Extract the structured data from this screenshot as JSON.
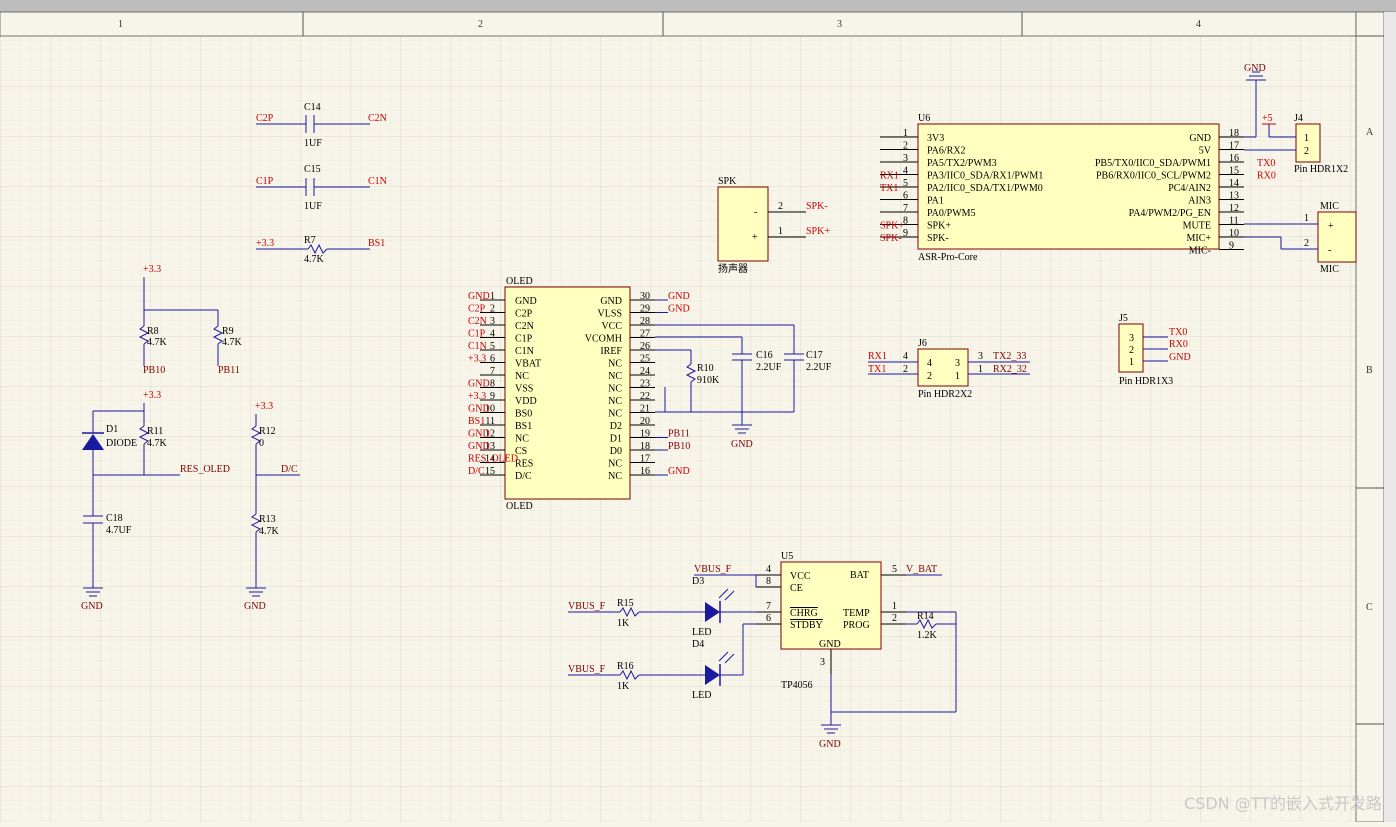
{
  "zones": {
    "columns": [
      "1",
      "2",
      "3",
      "4"
    ],
    "rows": [
      "A",
      "B",
      "C"
    ]
  },
  "caps": [
    {
      "ref": "C14",
      "value": "1UF",
      "left": "C2P",
      "right": "C2N"
    },
    {
      "ref": "C15",
      "value": "1UF",
      "left": "C1P",
      "right": "C1N"
    }
  ],
  "r7": {
    "ref": "R7",
    "value": "4.7K",
    "left": "+3.3",
    "right": "BS1"
  },
  "pullups": {
    "supply1": "+3.3",
    "supply2": "+3.3",
    "supply3": "+3.3",
    "r8": {
      "ref": "R8",
      "value": "4.7K",
      "net": "PB10"
    },
    "r9": {
      "ref": "R9",
      "value": "4.7K",
      "net": "PB11"
    },
    "d1": {
      "ref": "D1",
      "value": "DIODE"
    },
    "r11": {
      "ref": "R11",
      "value": "4.7K"
    },
    "c18": {
      "ref": "C18",
      "value": "4.7UF"
    },
    "res_net": "RES_OLED",
    "r12": {
      "ref": "R12",
      "value": "0"
    },
    "r13": {
      "ref": "R13",
      "value": "4.7K"
    },
    "dc_net": "D/C",
    "gnd": "GND"
  },
  "oled": {
    "ref": "OLED",
    "name": "OLED",
    "left_pins": [
      {
        "n": "1",
        "label": "GND",
        "net": "GND"
      },
      {
        "n": "2",
        "label": "C2P",
        "net": "C2P"
      },
      {
        "n": "3",
        "label": "C2N",
        "net": "C2N"
      },
      {
        "n": "4",
        "label": "C1P",
        "net": "C1P"
      },
      {
        "n": "5",
        "label": "C1N",
        "net": "C1N"
      },
      {
        "n": "6",
        "label": "VBAT",
        "net": "+3.3"
      },
      {
        "n": "7",
        "label": "NC",
        "net": ""
      },
      {
        "n": "8",
        "label": "VSS",
        "net": "GND"
      },
      {
        "n": "9",
        "label": "VDD",
        "net": "+3.3"
      },
      {
        "n": "10",
        "label": "BS0",
        "net": "GND"
      },
      {
        "n": "11",
        "label": "BS1",
        "net": "BS1"
      },
      {
        "n": "12",
        "label": "NC",
        "net": "GND"
      },
      {
        "n": "13",
        "label": "CS",
        "net": "GND"
      },
      {
        "n": "14",
        "label": "RES",
        "net": "RES_OLED"
      },
      {
        "n": "15",
        "label": "D/C",
        "net": "D/C"
      }
    ],
    "right_pins": [
      {
        "n": "30",
        "label": "GND",
        "net": "GND"
      },
      {
        "n": "29",
        "label": "VLSS",
        "net": "GND"
      },
      {
        "n": "28",
        "label": "VCC",
        "net": ""
      },
      {
        "n": "27",
        "label": "VCOMH",
        "net": ""
      },
      {
        "n": "26",
        "label": "IREF",
        "net": ""
      },
      {
        "n": "25",
        "label": "NC",
        "net": ""
      },
      {
        "n": "24",
        "label": "NC",
        "net": ""
      },
      {
        "n": "23",
        "label": "NC",
        "net": ""
      },
      {
        "n": "22",
        "label": "NC",
        "net": ""
      },
      {
        "n": "21",
        "label": "NC",
        "net": ""
      },
      {
        "n": "20",
        "label": "D2",
        "net": ""
      },
      {
        "n": "19",
        "label": "D1",
        "net": "PB11"
      },
      {
        "n": "18",
        "label": "D0",
        "net": "PB10"
      },
      {
        "n": "17",
        "label": "NC",
        "net": ""
      },
      {
        "n": "16",
        "label": "NC",
        "net": "GND"
      }
    ],
    "r10": {
      "ref": "R10",
      "value": "910K"
    },
    "c16": {
      "ref": "C16",
      "value": "2.2UF"
    },
    "c17": {
      "ref": "C17",
      "value": "2.2UF"
    },
    "gnd": "GND"
  },
  "spk": {
    "ref": "SPK",
    "comment": "扬声器",
    "pin_minus": "-",
    "pin_plus": "+",
    "n_minus": "2",
    "n_plus": "1",
    "net_minus": "SPK-",
    "net_plus": "SPK+"
  },
  "u6": {
    "ref": "U6",
    "name": "ASR-Pro-Core",
    "left_pins": [
      {
        "n": "1",
        "label": "3V3",
        "net": ""
      },
      {
        "n": "2",
        "label": "PA6/RX2",
        "net": ""
      },
      {
        "n": "3",
        "label": "PA5/TX2/PWM3",
        "net": ""
      },
      {
        "n": "4",
        "label": "PA3/IIC0_SDA/RX1/PWM1",
        "net": "RX1"
      },
      {
        "n": "5",
        "label": "PA2/IIC0_SDA/TX1/PWM0",
        "net": "TX1"
      },
      {
        "n": "6",
        "label": "PA1",
        "net": ""
      },
      {
        "n": "7",
        "label": "PA0/PWM5",
        "net": ""
      },
      {
        "n": "8",
        "label": "SPK+",
        "net": "SPK+"
      },
      {
        "n": "9",
        "label": "SPK-",
        "net": "SPK-"
      }
    ],
    "right_pins": [
      {
        "n": "18",
        "label": "GND",
        "net": ""
      },
      {
        "n": "17",
        "label": "5V",
        "net": ""
      },
      {
        "n": "16",
        "label": "PB5/TX0/IIC0_SDA/PWM1",
        "net": "TX0"
      },
      {
        "n": "15",
        "label": "PB6/RX0/IIC0_SCL/PWM2",
        "net": "RX0"
      },
      {
        "n": "14",
        "label": "PC4/AIN2",
        "net": ""
      },
      {
        "n": "13",
        "label": "AIN3",
        "net": ""
      },
      {
        "n": "12",
        "label": "PA4/PWM2/PG_EN",
        "net": ""
      },
      {
        "n": "11",
        "label": "MUTE",
        "net": ""
      },
      {
        "n": "10",
        "label": "MIC+",
        "net": ""
      },
      {
        "n": "9",
        "label": "MIC-",
        "net": ""
      }
    ],
    "gnd": "GND"
  },
  "j4": {
    "ref": "J4",
    "name": "Pin HDR1X2",
    "pins": [
      "1",
      "2"
    ],
    "supply": "+5"
  },
  "mic": {
    "ref": "MIC",
    "comment": "MIC",
    "n_plus": "1",
    "n_minus": "2",
    "pin_plus": "+",
    "pin_minus": "-"
  },
  "j6": {
    "ref": "J6",
    "name": "Pin HDR2X2",
    "left": [
      {
        "n": "4",
        "net": "RX1"
      },
      {
        "n": "2",
        "net": "TX1"
      }
    ],
    "inner": [
      "4",
      "3",
      "2",
      "1"
    ],
    "right": [
      {
        "n": "3",
        "net": "TX2_33"
      },
      {
        "n": "1",
        "net": "RX2_32"
      }
    ]
  },
  "j5": {
    "ref": "J5",
    "name": "Pin HDR1X3",
    "pins": [
      {
        "n": "3",
        "net": "TX0"
      },
      {
        "n": "2",
        "net": "RX0"
      },
      {
        "n": "1",
        "net": "GND"
      }
    ]
  },
  "u5": {
    "ref": "U5",
    "name": "TP4056",
    "left": [
      {
        "n": "4",
        "label": "VCC"
      },
      {
        "n": "8",
        "label": "CE"
      },
      {
        "n": "7",
        "label": "CHRG"
      },
      {
        "n": "6",
        "label": "STDBY"
      }
    ],
    "right": [
      {
        "n": "5",
        "label": "BAT"
      },
      {
        "n": "1",
        "label": "TEMP"
      },
      {
        "n": "2",
        "label": "PROG"
      }
    ],
    "bottom": {
      "n": "3",
      "label": "GND"
    },
    "vbus": "VBUS_F",
    "vbat": "V_BAT",
    "gnd": "GND",
    "r14": {
      "ref": "R14",
      "value": "1.2K"
    }
  },
  "leds": {
    "r15": {
      "ref": "R15",
      "value": "1K",
      "net": "VBUS_F"
    },
    "r16": {
      "ref": "R16",
      "value": "1K",
      "net": "VBUS_F"
    },
    "d3": {
      "ref": "D3",
      "value": "LED"
    },
    "d4": {
      "ref": "D4",
      "value": "LED"
    }
  },
  "watermark": "CSDN @TT的嵌入式开发路"
}
